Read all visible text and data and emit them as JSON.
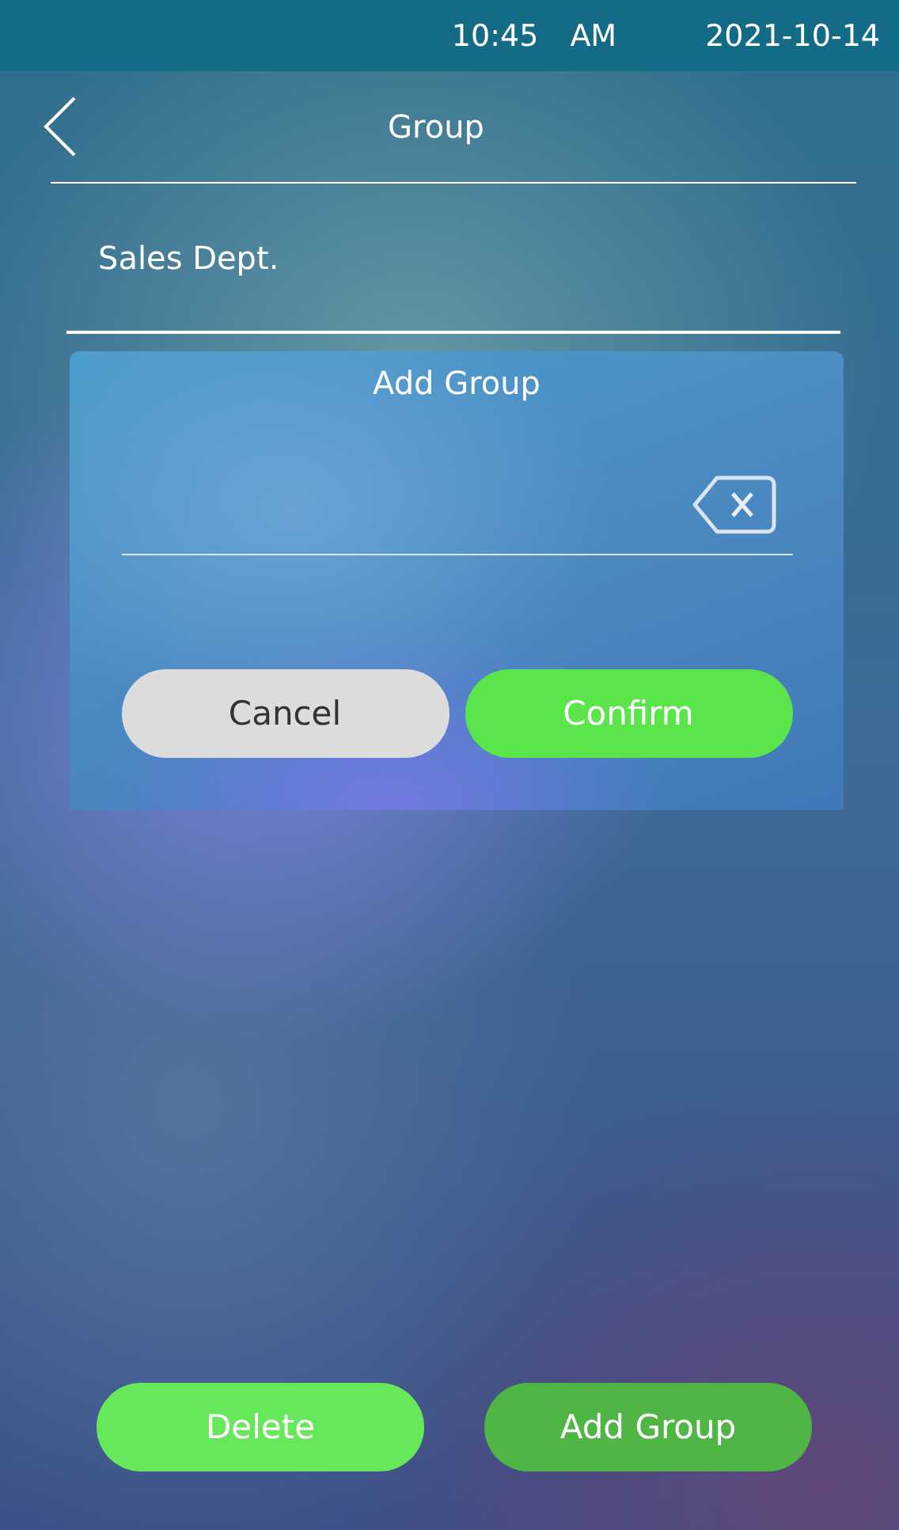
{
  "status_bar": {
    "time": "10:45",
    "meridiem": "AM",
    "date": "2021-10-14"
  },
  "header": {
    "title": "Group"
  },
  "groups": [
    {
      "name": "Sales Dept."
    }
  ],
  "dialog": {
    "title": "Add Group",
    "buttons": [
      {
        "label": "Cancel",
        "kind": "cancel"
      },
      {
        "label": "Confirm",
        "kind": "confirm"
      }
    ]
  },
  "actions": [
    {
      "label": "Delete",
      "pressed": false
    },
    {
      "label": "Add Group",
      "pressed": true
    }
  ]
}
